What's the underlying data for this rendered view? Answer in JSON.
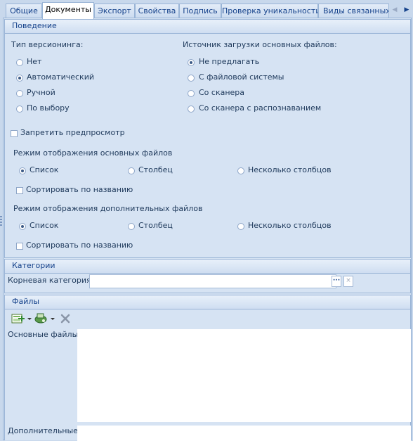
{
  "tabs": [
    {
      "label": "Общие"
    },
    {
      "label": "Документы",
      "active": true
    },
    {
      "label": "Экспорт"
    },
    {
      "label": "Свойства"
    },
    {
      "label": "Подпись"
    },
    {
      "label": "Проверка уникальности"
    },
    {
      "label": "Виды связанных з"
    }
  ],
  "behavior": {
    "title": "Поведение",
    "versioning": {
      "label": "Тип версионинга:",
      "options": [
        "Нет",
        "Автоматический",
        "Ручной",
        "По выбору"
      ],
      "selected": 1
    },
    "source": {
      "label": "Источник загрузки основных файлов:",
      "options": [
        "Не предлагать",
        "С файловой системы",
        "Со сканера",
        "Со сканера с распознаванием"
      ],
      "selected": 0
    },
    "disable_preview": "Запретить предпросмотр",
    "main_files_mode": {
      "label": "Режим отображения основных файлов",
      "options": [
        "Список",
        "Столбец",
        "Несколько столбцов"
      ],
      "selected": 0,
      "sort": "Сортировать по названию"
    },
    "extra_files_mode": {
      "label": "Режим отображения дополнительных файлов",
      "options": [
        "Список",
        "Столбец",
        "Несколько столбцов"
      ],
      "selected": 0,
      "sort": "Сортировать по названию"
    }
  },
  "categories": {
    "title": "Категории",
    "root_label": "Корневая категория:",
    "root_value": "",
    "browse_label": "···",
    "clear_label": "×"
  },
  "files": {
    "title": "Файлы",
    "main_label": "Основные файлы",
    "extra_label": "Дополнительные"
  },
  "colors": {
    "accent": "#15428b",
    "border": "#99b4d6",
    "panel": "#d6e3f3"
  }
}
